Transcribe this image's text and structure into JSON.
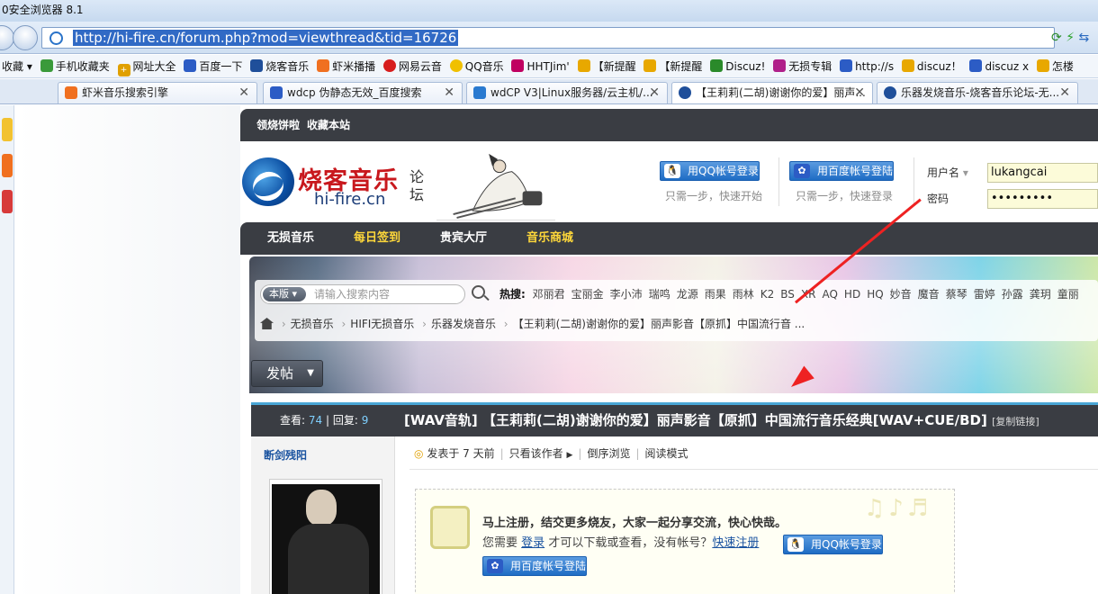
{
  "browser": {
    "title": "0安全浏览器 8.1",
    "url": "http://hi-fire.cn/forum.php?mod=viewthread&tid=16726",
    "bookmarks_label": "收藏",
    "bookmarks": [
      {
        "label": "手机收藏夹",
        "color": "#3a9a3a",
        "icon": "phone-icon"
      },
      {
        "label": "网址大全",
        "color": "#e0a000",
        "icon": "plus-icon"
      },
      {
        "label": "百度一下",
        "color": "#2c5cc5",
        "icon": "baidu-paw-icon"
      },
      {
        "label": "烧客音乐",
        "color": "#1f4f9a",
        "icon": "site-icon"
      },
      {
        "label": "虾米播播",
        "color": "#f07020",
        "icon": "xiami-icon"
      },
      {
        "label": "网易云音",
        "color": "#d71d1d",
        "icon": "netease-icon"
      },
      {
        "label": "QQ音乐",
        "color": "#f0c000",
        "icon": "qqmusic-icon"
      },
      {
        "label": "HHTJim'",
        "color": "#c00060",
        "icon": "site-icon"
      },
      {
        "label": "【新提醒",
        "color": "#e8a800",
        "icon": "trophy-icon"
      },
      {
        "label": "【新提醒",
        "color": "#e8a800",
        "icon": "trophy-icon"
      },
      {
        "label": "Discuz!",
        "color": "#2a8a2a",
        "icon": "discuz-icon"
      },
      {
        "label": "无损专辑",
        "color": "#b0208a",
        "icon": "site-icon"
      },
      {
        "label": "http://s",
        "color": "#2c5cc5",
        "icon": "site-icon"
      },
      {
        "label": "discuz！",
        "color": "#e8a800",
        "icon": "trophy-icon"
      },
      {
        "label": "discuz x",
        "color": "#2c5cc5",
        "icon": "baidu-paw-icon"
      },
      {
        "label": "怎楼",
        "color": "#e8a800",
        "icon": "trophy-icon"
      }
    ],
    "tabs": [
      {
        "label": "虾米音乐搜索引擎",
        "color": "#f07020"
      },
      {
        "label": "wdcp 伪静态无效_百度搜索",
        "color": "#2c5cc5"
      },
      {
        "label": "wdCP V3|Linux服务器/云主机/...",
        "color": "#2a7ad0"
      },
      {
        "label": "【王莉莉(二胡)谢谢你的爱】丽声...",
        "color": "#1f4f9a"
      },
      {
        "label": "乐器发烧音乐-烧客音乐论坛-无...",
        "color": "#1f4f9a"
      }
    ]
  },
  "site": {
    "top_links": [
      "领烧饼啦",
      "收藏本站"
    ],
    "logo_cn": "烧客音乐",
    "logo_en": "hi-fire.cn",
    "logo_suffix": "论坛",
    "qq_login_label": "用QQ帐号登录",
    "qq_hint": "只需一步，快速开始",
    "baidu_login_label": "用百度帐号登陆",
    "baidu_hint": "只需一步，快速登录",
    "username_label": "用户名",
    "username_value": "lukangcai",
    "password_label": "密码",
    "password_value": "•••••••••",
    "nav": [
      {
        "label": "无损音乐",
        "color": "#ffffff"
      },
      {
        "label": "每日签到",
        "color": "#ffd83a"
      },
      {
        "label": "贵宾大厅",
        "color": "#ffffff"
      },
      {
        "label": "音乐商城",
        "color": "#ffd83a"
      }
    ]
  },
  "search": {
    "version_label": "本版",
    "placeholder": "请输入搜索内容",
    "hot_label": "热搜:",
    "hot_terms": [
      "邓丽君",
      "宝丽金",
      "李小沛",
      "瑞鸣",
      "龙源",
      "雨果",
      "雨林",
      "K2",
      "BS",
      "XR",
      "AQ",
      "HD",
      "HQ",
      "妙音",
      "魔音",
      "蔡琴",
      "雷婷",
      "孙露",
      "龚玥",
      "童丽"
    ]
  },
  "breadcrumb": [
    "无损音乐",
    "HIFI无损音乐",
    "乐器发烧音乐",
    "【王莉莉(二胡)谢谢你的爱】丽声影音【原抓】中国流行音 ..."
  ],
  "post_button_label": "发帖",
  "thread": {
    "views_label": "查看:",
    "views": "74",
    "replies_label": "回复:",
    "replies": "9",
    "title": "[WAV音轨] 【王莉莉(二胡)谢谢你的爱】丽声影音【原抓】中国流行音乐经典[WAV+CUE/BD]",
    "copy_link": "[复制链接]",
    "author": "断剑残阳",
    "posted": "发表于 7 天前",
    "only_author": "只看该作者",
    "reverse": "倒序浏览",
    "read_mode": "阅读模式",
    "register_line1": "马上注册，结交更多烧友，大家一起分享交流，快心快哉。",
    "register_line2_a": "您需要",
    "login_link": "登录",
    "register_line2_b": "才可以下载或查看，没有帐号？",
    "register_link": "快速注册"
  },
  "colors": {
    "dark_bar": "#3a3d43",
    "link_blue": "#1a53a0",
    "highlight_url": "#316ac5",
    "nav_yellow": "#ffd83a"
  }
}
